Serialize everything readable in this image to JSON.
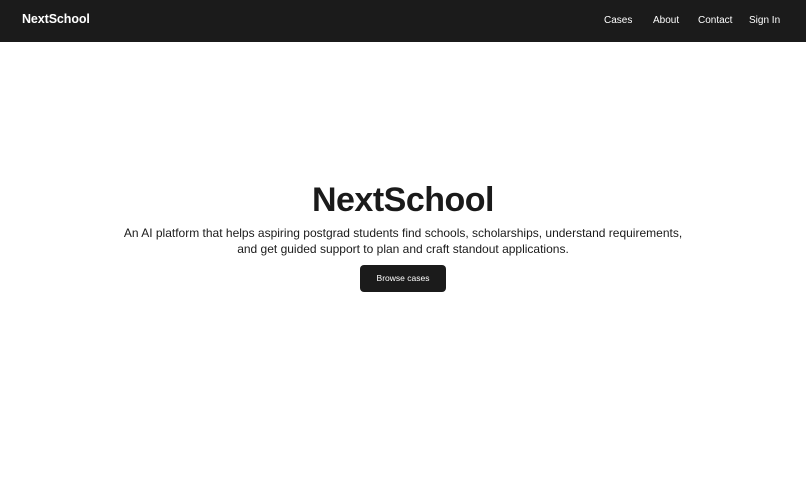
{
  "navbar": {
    "brand": "NextSchool",
    "links": [
      {
        "label": "Cases"
      },
      {
        "label": "About"
      },
      {
        "label": "Contact"
      },
      {
        "label": "Sign In"
      }
    ]
  },
  "hero": {
    "title": "NextSchool",
    "description": "An AI platform that helps aspiring postgrad students find schools, scholarships, understand requirements, and get guided support to plan and craft standout applications.",
    "cta_label": "Browse cases"
  },
  "colors": {
    "navbar_bg": "#1b1b1b",
    "page_bg": "#ffffff",
    "text": "#1a1a1a",
    "button_bg": "#1b1b1b",
    "button_text": "#ffffff"
  }
}
